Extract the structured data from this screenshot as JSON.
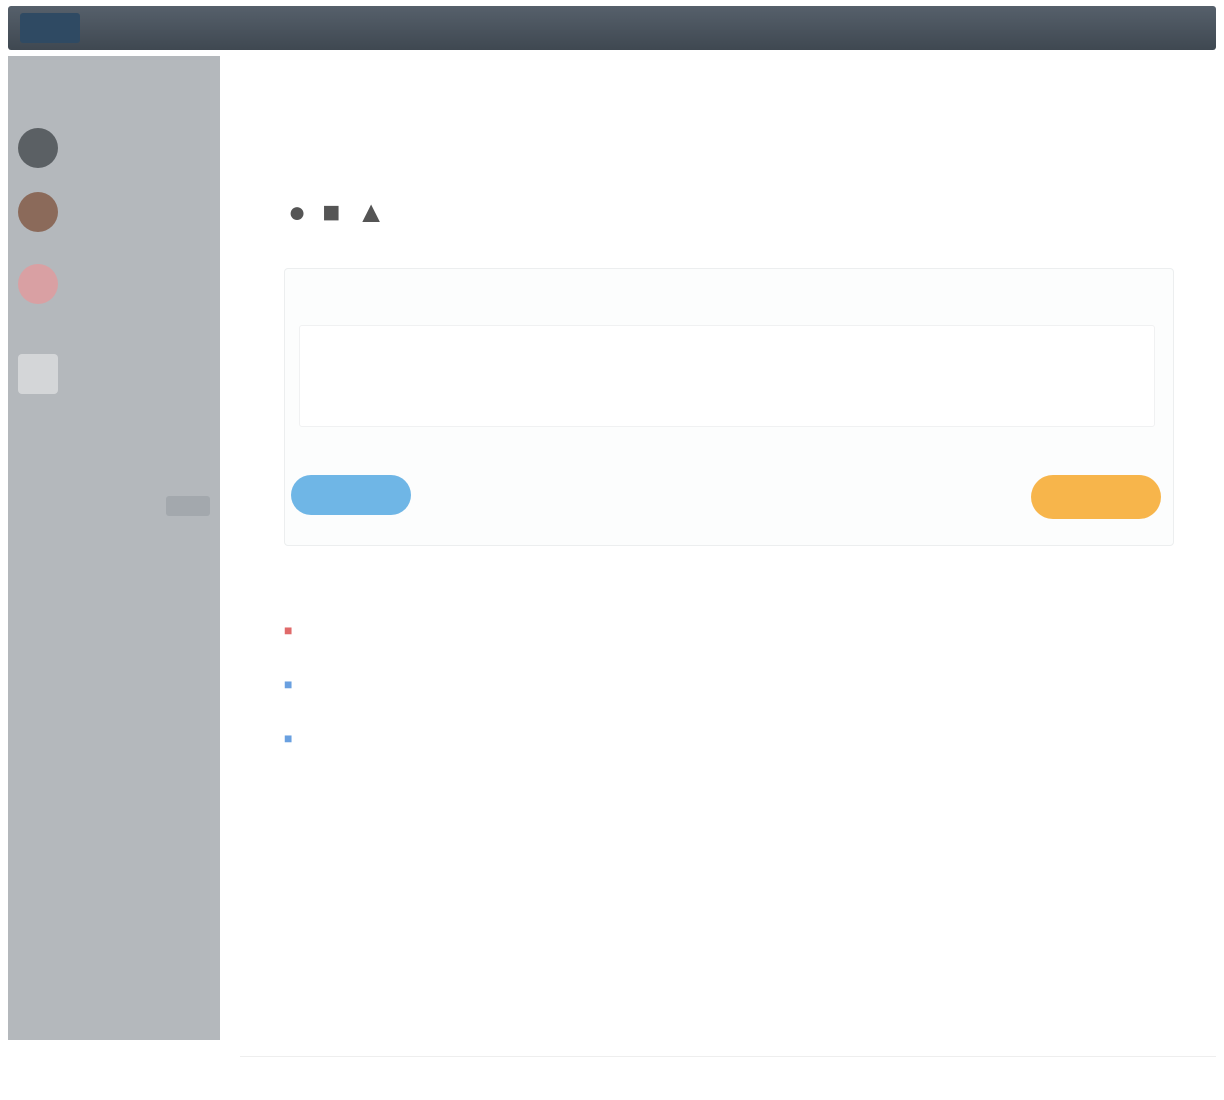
{
  "topbar": {
    "title": ""
  },
  "sidebar": {
    "heading": "",
    "items": [
      {
        "label": "",
        "color": "#5b6064"
      },
      {
        "label": "",
        "color": "#8b6a5a"
      },
      {
        "label": "",
        "color": "#d9a0a3"
      },
      {
        "label": "",
        "color": "#d4d6d8"
      }
    ],
    "links": [
      "",
      ""
    ]
  },
  "main": {
    "title": "",
    "subtitle": "",
    "composer": {
      "label": "",
      "placeholder": "",
      "hint_left": "",
      "hint_right": "",
      "post_button": "",
      "cancel_link": "",
      "orange_button": ""
    },
    "resources": {
      "header_right": "",
      "rows": [
        {
          "icon_color": "#e06a6a",
          "name": "",
          "col1": "",
          "col2": ""
        },
        {
          "icon_color": "#6aa0e0",
          "name": "",
          "col1": "",
          "col2": ""
        },
        {
          "icon_color": "#6aa0e0",
          "name": "",
          "col1": "",
          "col2": ""
        }
      ]
    },
    "footer": {
      "left": "",
      "middle": "",
      "right": ""
    }
  }
}
